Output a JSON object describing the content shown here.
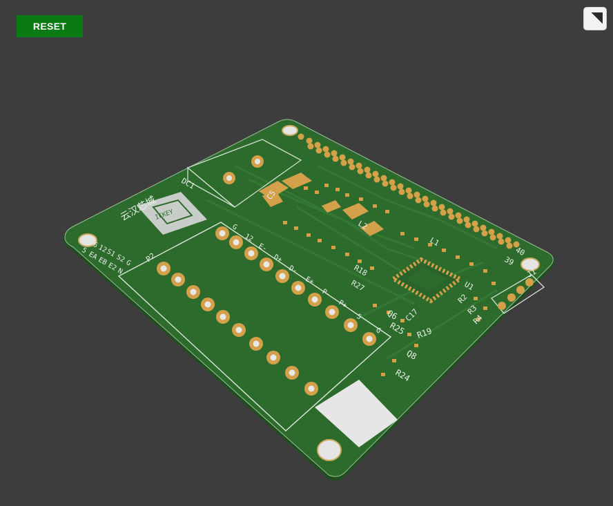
{
  "toolbar": {
    "reset_label": "RESET",
    "fullscreen_icon": "expand-icon"
  },
  "board": {
    "logo_text": "云汉芯城",
    "logo_badge": "ICKEY",
    "colors": {
      "background": "#3d3d3d",
      "pcb": "#2c6a2c",
      "pad": "#d4a04a",
      "silk": "#e8eee8",
      "button": "#0a7a12"
    },
    "labels": {
      "dc1": "DC1",
      "p2": "P2",
      "j1": "J1",
      "u1": "U1",
      "l1": "L1",
      "l2": "L2",
      "c5": "C5",
      "pin39": "39",
      "pin40": "40",
      "r19": "R19",
      "r24": "R24",
      "r25": "R25",
      "q6": "Q6",
      "q8": "Q8",
      "c17": "C17",
      "r2": "R2",
      "r3": "R3",
      "r4": "R4",
      "r18": "R18",
      "r27": "R27",
      "pins_right": [
        "G",
        "5",
        "P+",
        "P-",
        "E+",
        "D-",
        "D+",
        "E-",
        "12",
        "G"
      ],
      "p2_row_top": [
        "6",
        "12",
        "S1",
        "S2",
        "G"
      ],
      "p2_row_bottom": [
        "5",
        "EA",
        "EB",
        "E2",
        "N"
      ]
    }
  }
}
